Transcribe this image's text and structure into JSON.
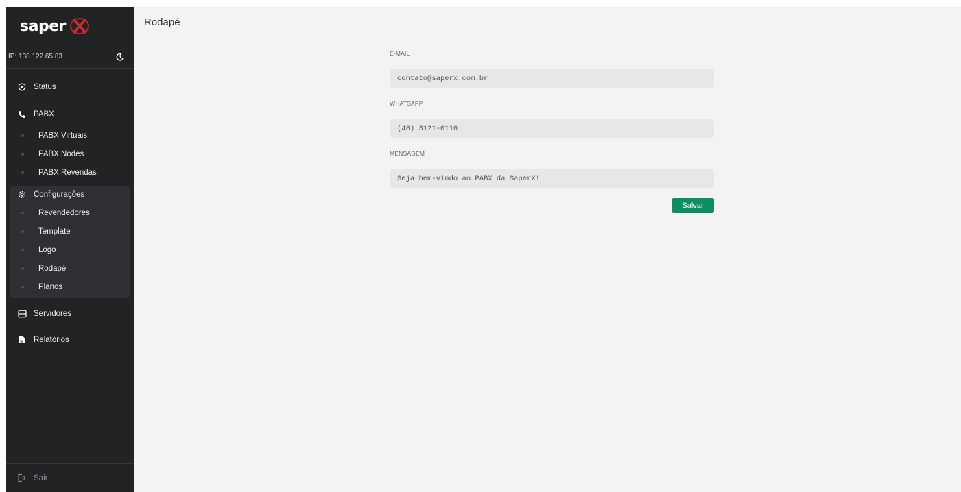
{
  "brand": {
    "name": "saper",
    "x_color": "#d42a2a"
  },
  "server": {
    "ip_label": "IP: 138.122.65.83"
  },
  "sidebar": {
    "status": "Status",
    "pabx": {
      "label": "PABX",
      "items": [
        "PABX Virtuais",
        "PABX Nodes",
        "PABX Revendas"
      ]
    },
    "config": {
      "label": "Configurações",
      "items": [
        "Revendedores",
        "Template",
        "Logo",
        "Rodapé",
        "Planos"
      ]
    },
    "servers": "Servidores",
    "reports": "Relatórios",
    "logout": "Sair"
  },
  "main": {
    "title": "Rodapé",
    "form": {
      "email_label": "E-MAIL",
      "email_value": "contato@saperx.com.br",
      "whatsapp_label": "WHATSAPP",
      "whatsapp_value": "(48) 3121-0110",
      "message_label": "MENSAGEM",
      "message_value": "Seja bem-vindo ao PABX da SaperX!",
      "save_label": "Salvar"
    }
  },
  "colors": {
    "sidebar_bg": "#222325",
    "main_bg": "#f3f3f3",
    "accent": "#0e8f63"
  }
}
